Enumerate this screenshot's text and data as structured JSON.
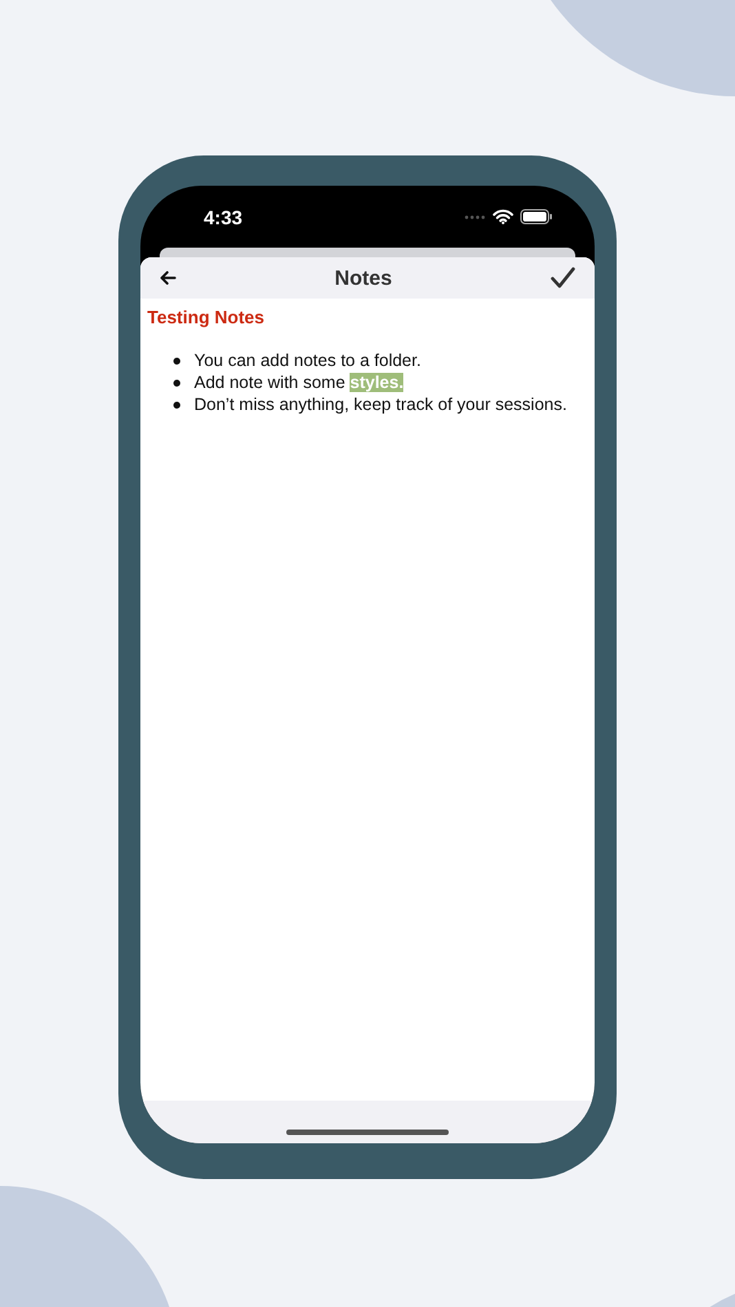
{
  "status_bar": {
    "time": "4:33"
  },
  "nav_bar": {
    "title": "Notes"
  },
  "note": {
    "title": "Testing Notes",
    "items": [
      {
        "segments": [
          {
            "text": "You can add notes to a folder.",
            "highlight": false
          }
        ]
      },
      {
        "segments": [
          {
            "text": "Add note with some ",
            "highlight": false
          },
          {
            "text": "styles.",
            "highlight": true
          }
        ]
      },
      {
        "segments": [
          {
            "text": "Don’t miss anything, keep track of your sessions.",
            "highlight": false
          }
        ]
      }
    ]
  }
}
